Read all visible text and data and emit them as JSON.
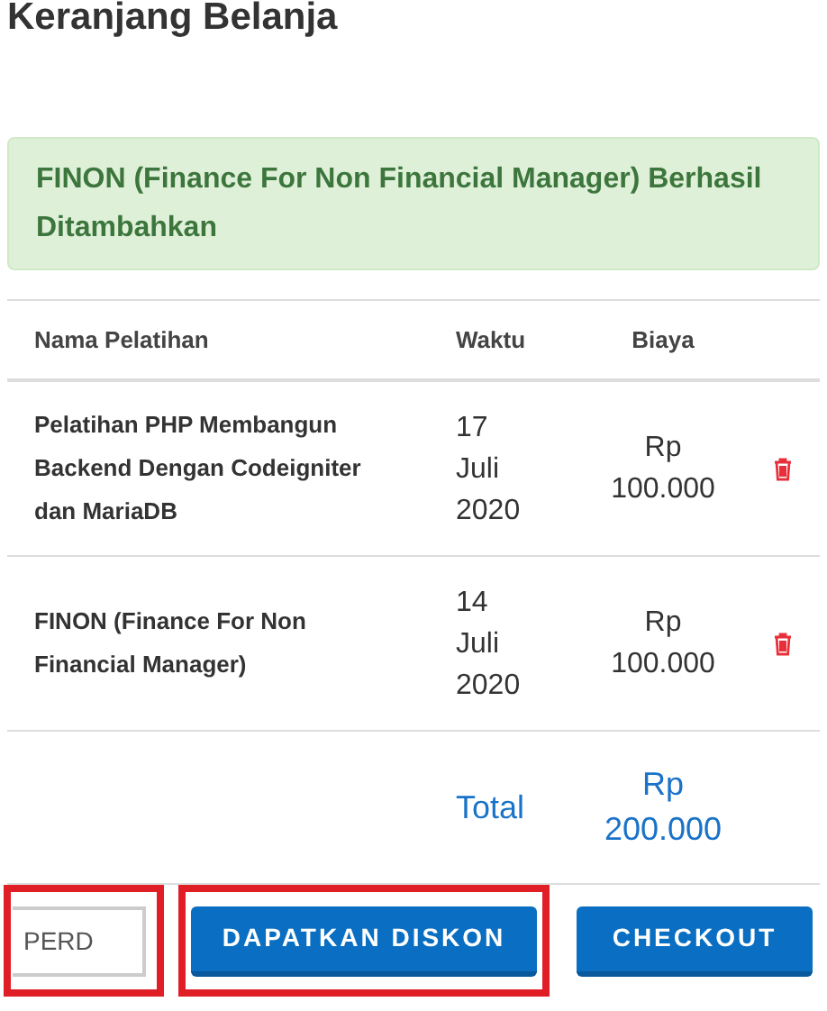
{
  "page_title": "Keranjang Belanja",
  "alert": {
    "message": "FINON (Finance For Non Financial Manager) Berhasil Ditambahkan"
  },
  "table": {
    "columns": [
      "Nama Pelatihan",
      "Waktu",
      "Biaya"
    ],
    "rows": [
      {
        "name": "Pelatihan PHP Membangun Backend Dengan Codeigniter dan MariaDB",
        "date": [
          "17",
          "Juli",
          "2020"
        ],
        "price": [
          "Rp",
          "100.000"
        ]
      },
      {
        "name": "FINON (Finance For Non Financial Manager)",
        "date": [
          "14",
          "Juli",
          "2020"
        ],
        "price": [
          "Rp",
          "100.000"
        ]
      }
    ],
    "total": {
      "label": "Total",
      "amount": [
        "Rp",
        "200.000"
      ]
    }
  },
  "discount_field": {
    "value": "PERD",
    "highlighted": true
  },
  "buttons": [
    {
      "label": "DAPATKAN DISKON",
      "highlighted": true
    },
    {
      "label": "CHECKOUT",
      "highlighted": false
    }
  ]
}
